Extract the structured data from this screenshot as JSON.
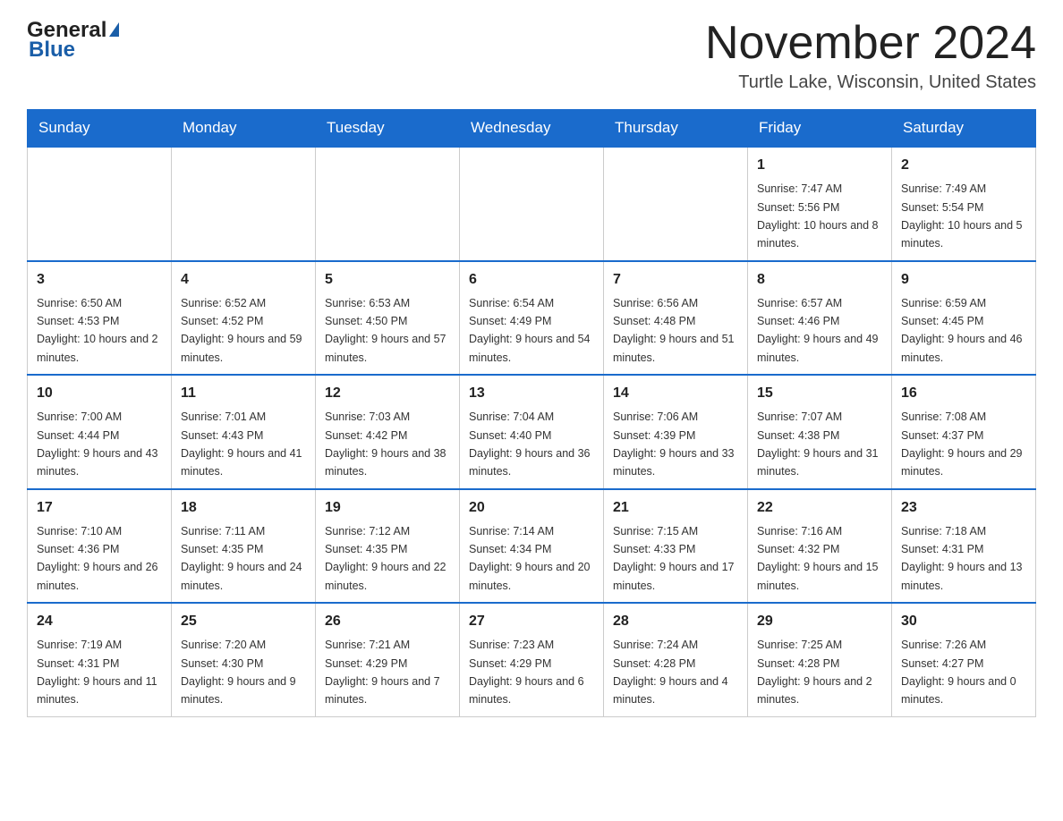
{
  "header": {
    "logo_line1": "General",
    "logo_line2": "Blue",
    "month_title": "November 2024",
    "location": "Turtle Lake, Wisconsin, United States"
  },
  "days_of_week": [
    "Sunday",
    "Monday",
    "Tuesday",
    "Wednesday",
    "Thursday",
    "Friday",
    "Saturday"
  ],
  "weeks": [
    [
      {
        "day": "",
        "info": ""
      },
      {
        "day": "",
        "info": ""
      },
      {
        "day": "",
        "info": ""
      },
      {
        "day": "",
        "info": ""
      },
      {
        "day": "",
        "info": ""
      },
      {
        "day": "1",
        "info": "Sunrise: 7:47 AM\nSunset: 5:56 PM\nDaylight: 10 hours and 8 minutes."
      },
      {
        "day": "2",
        "info": "Sunrise: 7:49 AM\nSunset: 5:54 PM\nDaylight: 10 hours and 5 minutes."
      }
    ],
    [
      {
        "day": "3",
        "info": "Sunrise: 6:50 AM\nSunset: 4:53 PM\nDaylight: 10 hours and 2 minutes."
      },
      {
        "day": "4",
        "info": "Sunrise: 6:52 AM\nSunset: 4:52 PM\nDaylight: 9 hours and 59 minutes."
      },
      {
        "day": "5",
        "info": "Sunrise: 6:53 AM\nSunset: 4:50 PM\nDaylight: 9 hours and 57 minutes."
      },
      {
        "day": "6",
        "info": "Sunrise: 6:54 AM\nSunset: 4:49 PM\nDaylight: 9 hours and 54 minutes."
      },
      {
        "day": "7",
        "info": "Sunrise: 6:56 AM\nSunset: 4:48 PM\nDaylight: 9 hours and 51 minutes."
      },
      {
        "day": "8",
        "info": "Sunrise: 6:57 AM\nSunset: 4:46 PM\nDaylight: 9 hours and 49 minutes."
      },
      {
        "day": "9",
        "info": "Sunrise: 6:59 AM\nSunset: 4:45 PM\nDaylight: 9 hours and 46 minutes."
      }
    ],
    [
      {
        "day": "10",
        "info": "Sunrise: 7:00 AM\nSunset: 4:44 PM\nDaylight: 9 hours and 43 minutes."
      },
      {
        "day": "11",
        "info": "Sunrise: 7:01 AM\nSunset: 4:43 PM\nDaylight: 9 hours and 41 minutes."
      },
      {
        "day": "12",
        "info": "Sunrise: 7:03 AM\nSunset: 4:42 PM\nDaylight: 9 hours and 38 minutes."
      },
      {
        "day": "13",
        "info": "Sunrise: 7:04 AM\nSunset: 4:40 PM\nDaylight: 9 hours and 36 minutes."
      },
      {
        "day": "14",
        "info": "Sunrise: 7:06 AM\nSunset: 4:39 PM\nDaylight: 9 hours and 33 minutes."
      },
      {
        "day": "15",
        "info": "Sunrise: 7:07 AM\nSunset: 4:38 PM\nDaylight: 9 hours and 31 minutes."
      },
      {
        "day": "16",
        "info": "Sunrise: 7:08 AM\nSunset: 4:37 PM\nDaylight: 9 hours and 29 minutes."
      }
    ],
    [
      {
        "day": "17",
        "info": "Sunrise: 7:10 AM\nSunset: 4:36 PM\nDaylight: 9 hours and 26 minutes."
      },
      {
        "day": "18",
        "info": "Sunrise: 7:11 AM\nSunset: 4:35 PM\nDaylight: 9 hours and 24 minutes."
      },
      {
        "day": "19",
        "info": "Sunrise: 7:12 AM\nSunset: 4:35 PM\nDaylight: 9 hours and 22 minutes."
      },
      {
        "day": "20",
        "info": "Sunrise: 7:14 AM\nSunset: 4:34 PM\nDaylight: 9 hours and 20 minutes."
      },
      {
        "day": "21",
        "info": "Sunrise: 7:15 AM\nSunset: 4:33 PM\nDaylight: 9 hours and 17 minutes."
      },
      {
        "day": "22",
        "info": "Sunrise: 7:16 AM\nSunset: 4:32 PM\nDaylight: 9 hours and 15 minutes."
      },
      {
        "day": "23",
        "info": "Sunrise: 7:18 AM\nSunset: 4:31 PM\nDaylight: 9 hours and 13 minutes."
      }
    ],
    [
      {
        "day": "24",
        "info": "Sunrise: 7:19 AM\nSunset: 4:31 PM\nDaylight: 9 hours and 11 minutes."
      },
      {
        "day": "25",
        "info": "Sunrise: 7:20 AM\nSunset: 4:30 PM\nDaylight: 9 hours and 9 minutes."
      },
      {
        "day": "26",
        "info": "Sunrise: 7:21 AM\nSunset: 4:29 PM\nDaylight: 9 hours and 7 minutes."
      },
      {
        "day": "27",
        "info": "Sunrise: 7:23 AM\nSunset: 4:29 PM\nDaylight: 9 hours and 6 minutes."
      },
      {
        "day": "28",
        "info": "Sunrise: 7:24 AM\nSunset: 4:28 PM\nDaylight: 9 hours and 4 minutes."
      },
      {
        "day": "29",
        "info": "Sunrise: 7:25 AM\nSunset: 4:28 PM\nDaylight: 9 hours and 2 minutes."
      },
      {
        "day": "30",
        "info": "Sunrise: 7:26 AM\nSunset: 4:27 PM\nDaylight: 9 hours and 0 minutes."
      }
    ]
  ]
}
